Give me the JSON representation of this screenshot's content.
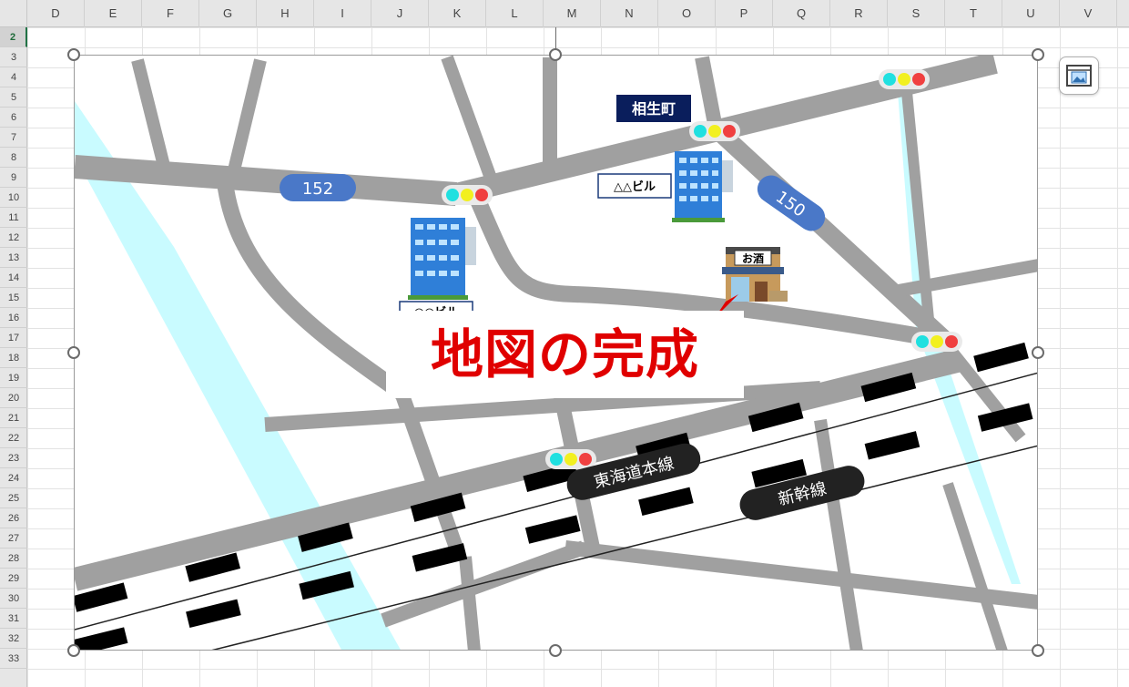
{
  "spreadsheet": {
    "columns": [
      "D",
      "E",
      "F",
      "G",
      "H",
      "I",
      "J",
      "K",
      "L",
      "M",
      "N",
      "O",
      "P",
      "Q",
      "R",
      "S",
      "T",
      "U",
      "V"
    ],
    "rows": [
      "2",
      "3",
      "4",
      "5",
      "6",
      "7",
      "8",
      "9",
      "10",
      "11",
      "12",
      "13",
      "14",
      "15",
      "16",
      "17",
      "18",
      "19",
      "20",
      "21",
      "22",
      "23",
      "24",
      "25",
      "26",
      "27",
      "28",
      "29",
      "30",
      "31",
      "32",
      "33"
    ],
    "selected_row": "2"
  },
  "map": {
    "headline": "地図の完成",
    "route_152": "152",
    "route_150": "150",
    "station_label": "相生町",
    "building_label_1": "△△ビル",
    "building_label_2": "○○ビル",
    "sake_shop_sign": "お酒",
    "rail_tokaido": "東海道本線",
    "rail_shinkansen": "新幹線"
  },
  "colors": {
    "road": "#a0a0a0",
    "river": "#c9fbff",
    "route_badge": "#4a78c8",
    "station_badge": "#0a1e5c",
    "rail_label": "#222222",
    "headline": "#e00000",
    "header_bg": "#e6e6e6"
  },
  "icons": {
    "layout_options": "layout-options-icon",
    "traffic_light": "traffic-light-icon",
    "building": "office-building-icon",
    "sake_shop": "sake-shop-icon"
  }
}
